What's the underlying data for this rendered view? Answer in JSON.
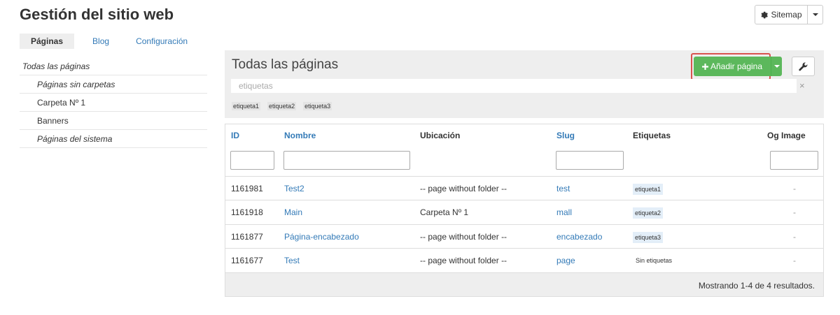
{
  "header": {
    "title": "Gestión del sitio web",
    "sitemap_label": "Sitemap"
  },
  "tabs": [
    {
      "label": "Páginas",
      "active": true
    },
    {
      "label": "Blog",
      "active": false
    },
    {
      "label": "Configuración",
      "active": false
    }
  ],
  "sidebar": {
    "items": [
      {
        "label": "Todas las páginas"
      },
      {
        "label": "Páginas sin carpetas"
      },
      {
        "label": "Carpeta Nº 1"
      },
      {
        "label": "Banners"
      },
      {
        "label": "Páginas del sistema"
      }
    ]
  },
  "panel": {
    "title": "Todas las páginas",
    "add_label": "Añadir página",
    "tags_placeholder": "etiquetas",
    "clear_label": "×",
    "tag_filters": [
      "etiqueta1",
      "etiqueta2",
      "etiqueta3"
    ]
  },
  "table": {
    "columns": [
      "ID",
      "Nombre",
      "Ubicación",
      "Slug",
      "Etiquetas",
      "Og Image"
    ],
    "rows": [
      {
        "id": "1161981",
        "name": "Test2",
        "location": "-- page without folder --",
        "slug": "test",
        "tag": "etiqueta1",
        "og": "-"
      },
      {
        "id": "1161918",
        "name": "Main",
        "location": "Carpeta Nº 1",
        "slug": "mall",
        "tag": "etiqueta2",
        "og": "-"
      },
      {
        "id": "1161877",
        "name": "Página-encabezado",
        "location": "-- page without folder --",
        "slug": "encabezado",
        "tag": "etiqueta3",
        "og": "-"
      },
      {
        "id": "1161677",
        "name": "Test",
        "location": "-- page without folder --",
        "slug": "page",
        "tag": "Sin etiquetas",
        "og": "-"
      }
    ],
    "footer": "Mostrando 1-4 de 4 resultados."
  },
  "colors": {
    "accent": "#337ab7",
    "success": "#5cb85c",
    "highlight": "#d9534f"
  }
}
